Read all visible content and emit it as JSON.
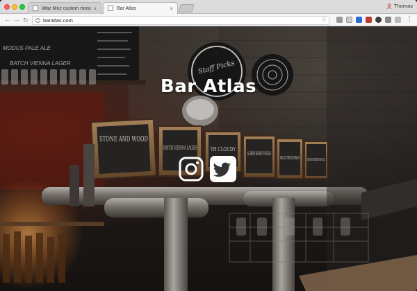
{
  "browser": {
    "tabs": [
      {
        "title": "Waz Moz custom mosaic desi",
        "active": false
      },
      {
        "title": "Bar Atlas",
        "active": true
      }
    ],
    "profile_name": "Thomas",
    "url": "baratlas.com"
  },
  "page": {
    "site_title": "Bar Atlas",
    "social_links": [
      {
        "name": "instagram",
        "icon": "instagram-icon"
      },
      {
        "name": "twitter",
        "icon": "twitter-bird-icon"
      }
    ]
  },
  "photo_text": {
    "tap_signs": [
      "STONE AND WOOD",
      "BATCH VIENNA LAGER",
      "YH CLOUDY",
      "ALLSBREW HIGHWAY TO HELLES",
      "WILLIE THE BOATMAN",
      "BOOKS BOXER RED ALE"
    ],
    "chalkboard": [
      "MODUS PALE ALE",
      "BATCH VIENNA LAGER"
    ],
    "badge": "Staff Picks"
  },
  "colors": {
    "title": "#ffffff",
    "icon_stroke": "#ffffff"
  }
}
